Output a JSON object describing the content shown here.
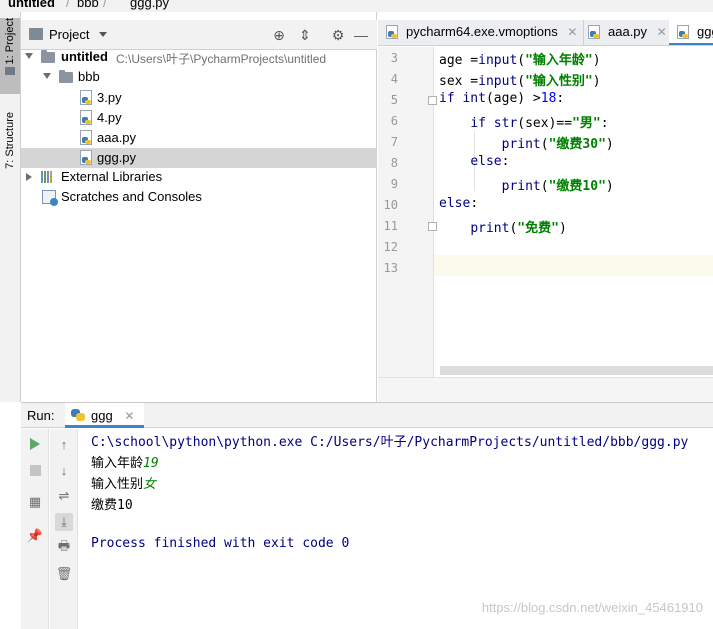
{
  "breadcrumb": {
    "items": [
      "untitled",
      "bbb",
      "ggg.py"
    ]
  },
  "tool_strip": {
    "project_label": "1: Project",
    "structure_label": "7: Structure"
  },
  "project_panel": {
    "title": "Project",
    "tree": {
      "root_name": "untitled",
      "root_path": "C:\\Users\\叶子\\PycharmProjects\\untitled",
      "folder_name": "bbb",
      "files": [
        "3.py",
        "4.py",
        "aaa.py",
        "ggg.py"
      ],
      "external_libraries": "External Libraries",
      "scratches": "Scratches and Consoles"
    }
  },
  "editor": {
    "tabs": [
      {
        "label": "pycharm64.exe.vmoptions"
      },
      {
        "label": "aaa.py"
      },
      {
        "label": "ggg"
      }
    ],
    "line_numbers": [
      "3",
      "4",
      "5",
      "6",
      "7",
      "8",
      "9",
      "10",
      "11",
      "12",
      "13"
    ],
    "code": {
      "l3_var": "age =",
      "l3_fn": "input",
      "l3_open": "(",
      "l3_str": "\"输入年龄\"",
      "l3_close": ")",
      "l4_var": "sex =",
      "l4_fn": "input",
      "l4_open": "(",
      "l4_str": "\"输入性别\"",
      "l4_close": ")",
      "l5_kw": "if",
      "l5_fn": "int",
      "l5_mid": "(age) >",
      "l5_num": "18",
      "l5_end": ":",
      "l6_kw": "if",
      "l6_fn": "str",
      "l6_mid": "(sex)==",
      "l6_str": "\"男\"",
      "l6_end": ":",
      "l7_fn": "print",
      "l7_open": "(",
      "l7_str": "\"缴费30\"",
      "l7_close": ")",
      "l8_kw": "else",
      "l8_end": ":",
      "l9_fn": "print",
      "l9_open": "(",
      "l9_str": "\"缴费10\"",
      "l9_close": ")",
      "l10_kw": "else",
      "l10_end": ":",
      "l11_fn": "print",
      "l11_open": "(",
      "l11_str": "\"免费\"",
      "l11_close": ")"
    }
  },
  "run_panel": {
    "title": "Run:",
    "tab_label": "ggg",
    "console": {
      "command": "C:\\school\\python\\python.exe C:/Users/叶子/PycharmProjects/untitled/bbb/ggg.py",
      "prompt_age": "输入年龄",
      "input_age": "19",
      "prompt_sex": "输入性别",
      "input_sex": "女",
      "result": "缴费10",
      "process_exit": "Process finished with exit code 0"
    },
    "watermark": "https://blog.csdn.net/weixin_45461910"
  },
  "colors": {
    "keyword": "#000080",
    "string": "#008000",
    "number": "#0000ff",
    "accent": "#4083c9",
    "run_green": "#59a869"
  }
}
